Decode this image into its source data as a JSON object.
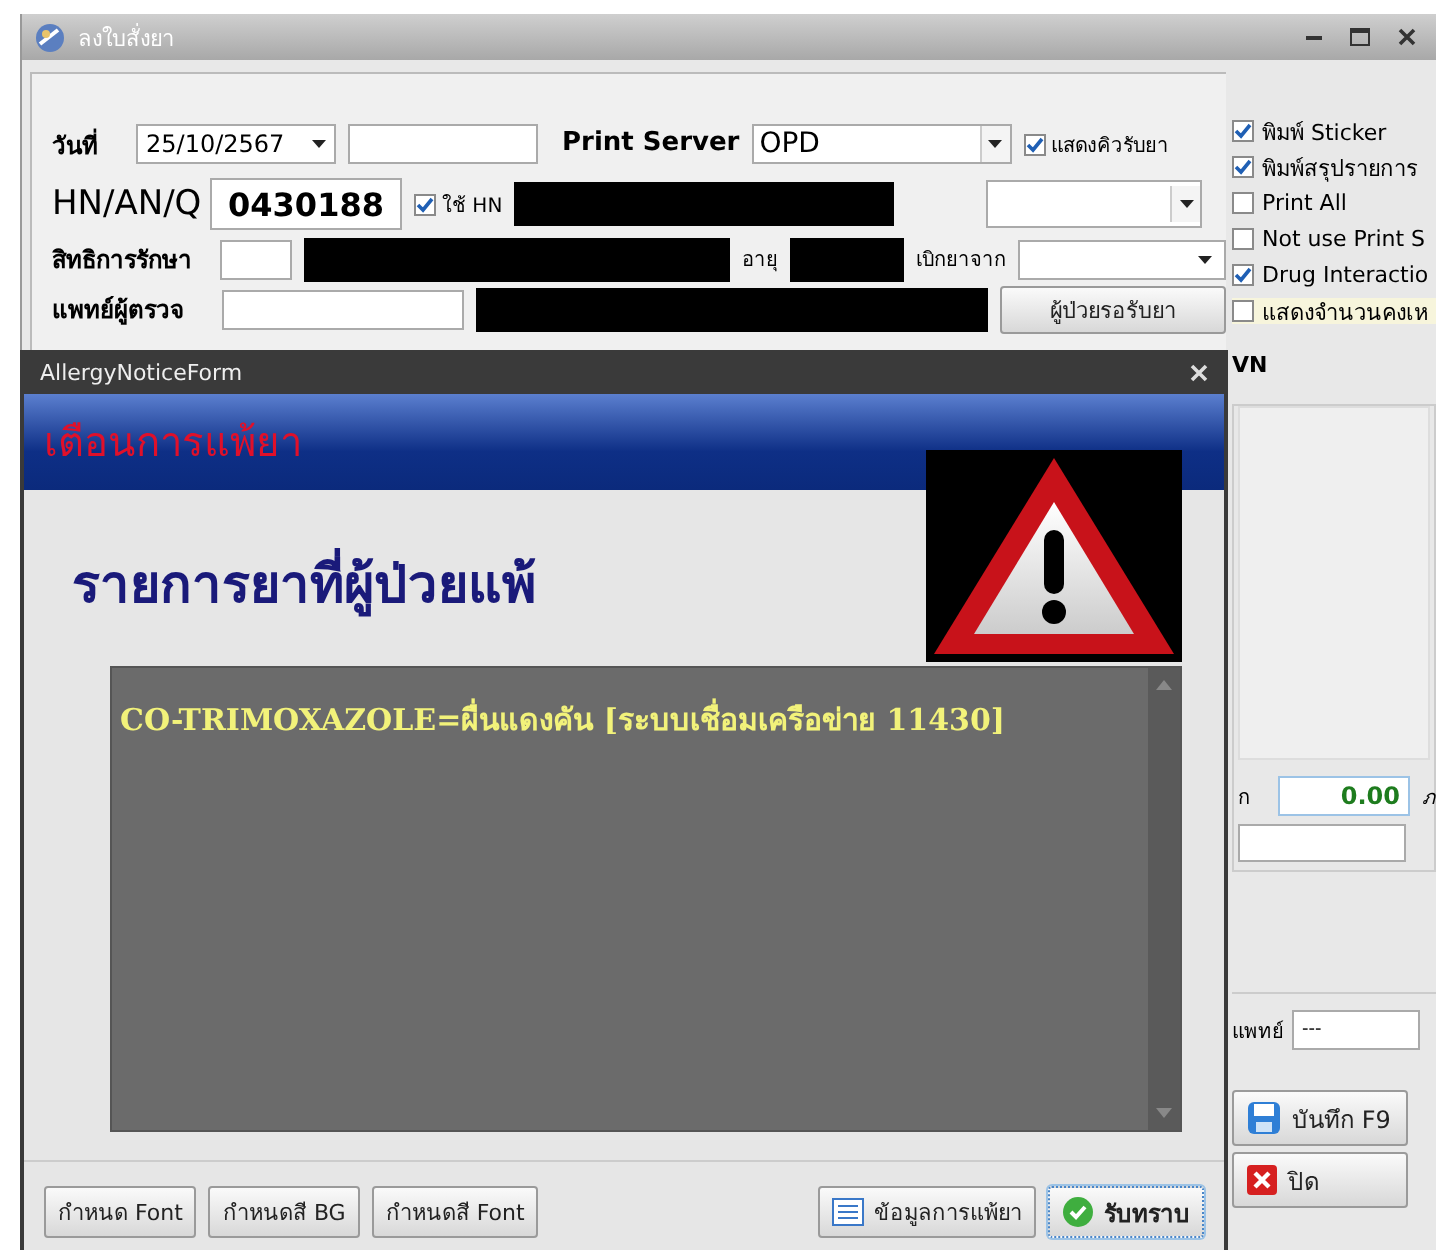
{
  "main_window": {
    "title": "ลงใบสั่งยา"
  },
  "form": {
    "date_label": "วันที่",
    "date_value": "25/10/2567",
    "print_server_label": "Print Server",
    "print_server_value": "OPD",
    "show_queue": {
      "label": "แสดงคิวรับยา",
      "checked": true
    },
    "hn_label": "HN/AN/Q",
    "hn_value": "0430188",
    "use_hn": {
      "label": "ใช้ HN",
      "checked": true
    },
    "rights_label": "สิทธิการรักษา",
    "age_label": "อายุ",
    "claim_label": "เบิกยาจาก",
    "doctor_label": "แพทย์ผู้ตรวจ",
    "waiting_button": "ผู้ป่วยรอรับยา"
  },
  "options": [
    {
      "label": "พิมพ์ Sticker",
      "checked": true
    },
    {
      "label": "พิมพ์สรุปรายการ",
      "checked": true
    },
    {
      "label": "Print All",
      "checked": false
    },
    {
      "label": "Not use Print S",
      "checked": false
    },
    {
      "label": "Drug Interactio",
      "checked": true
    },
    {
      "label": "แสดงจำนวนคงเห",
      "checked": false
    }
  ],
  "vn_label": "VN",
  "amount_label": "ก",
  "amount_value": "0.00",
  "amount_unit": "ภ",
  "doctor2_label": "แพทย์",
  "doctor2_value": "---",
  "save_button": "บันทึก F9",
  "close_button": "ปิด",
  "dialog": {
    "title": "AllergyNoticeForm",
    "header": "เตือนการแพ้ยา",
    "subtitle": "รายการยาที่ผู้ป่วยแพ้",
    "allergies": [
      "CO-TRIMOXAZOLE=ผื่นแดงคัน [ระบบเชื่อมเครือข่าย 11430]"
    ],
    "buttons": [
      {
        "label": "กำหนด Font",
        "kind": "plain",
        "focused": false
      },
      {
        "label": "กำหนดสี BG",
        "kind": "plain",
        "focused": false
      },
      {
        "label": "กำหนดสี Font",
        "kind": "plain",
        "focused": false
      },
      {
        "label": "ข้อมูลการแพ้ยา",
        "kind": "list",
        "focused": false
      },
      {
        "label": "รับทราบ",
        "kind": "check",
        "focused": true
      }
    ]
  }
}
